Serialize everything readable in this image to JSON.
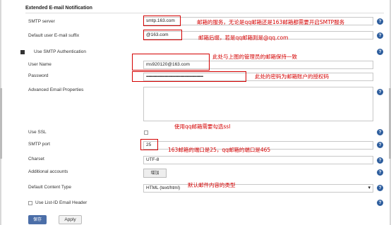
{
  "section_title": "Extended E-mail Notification",
  "fields": {
    "smtp_server": {
      "label": "SMTP server",
      "value": "smtp.163.com"
    },
    "email_suffix": {
      "label": "Default user E-mail suffix",
      "value": "@163.com"
    },
    "use_smtp_auth": {
      "label": "Use SMTP Authentication"
    },
    "user_name": {
      "label": "User Name",
      "value": "ms920120@163.com"
    },
    "password": {
      "label": "Password",
      "value": "••••••••••••••••••••••••••••••••••••••••••••••••••••••••••••••••••••••"
    },
    "advanced_props": {
      "label": "Advanced Email Properties",
      "value": ""
    },
    "use_ssl": {
      "label": "Use SSL"
    },
    "smtp_port": {
      "label": "SMTP port",
      "value": "25"
    },
    "charset": {
      "label": "Charset",
      "value": "UTF-8"
    },
    "additional_accounts": {
      "label": "Additional accounts",
      "button": "增加"
    },
    "content_type": {
      "label": "Default Content Type",
      "value": "HTML (text/html)"
    },
    "list_id": {
      "label": "Use List-ID Email Header"
    }
  },
  "annotations": {
    "smtp_server": "邮箱的服务，无论是qq邮箱还是163邮箱都需要开启SMTP服务",
    "email_suffix": "邮箱后缀，若是qq邮箱则是@qq.com",
    "user_name": "此处与上图的管理员的邮箱保持一致",
    "password": "此处的密码为邮箱账户的授权码",
    "use_ssl": "使用qq邮箱需要勾选ssl",
    "smtp_port": "163邮箱的端口是25，qq邮箱的端口是465",
    "content_type": "默认邮件内容的类型"
  },
  "buttons": {
    "save": "保存",
    "apply": "Apply"
  },
  "icons": {
    "help": "?",
    "dropdown": "▾"
  },
  "colors": {
    "annotation_red": "#d40000",
    "help_blue": "#2e5e9e",
    "save_bg": "#4b6ea8"
  }
}
